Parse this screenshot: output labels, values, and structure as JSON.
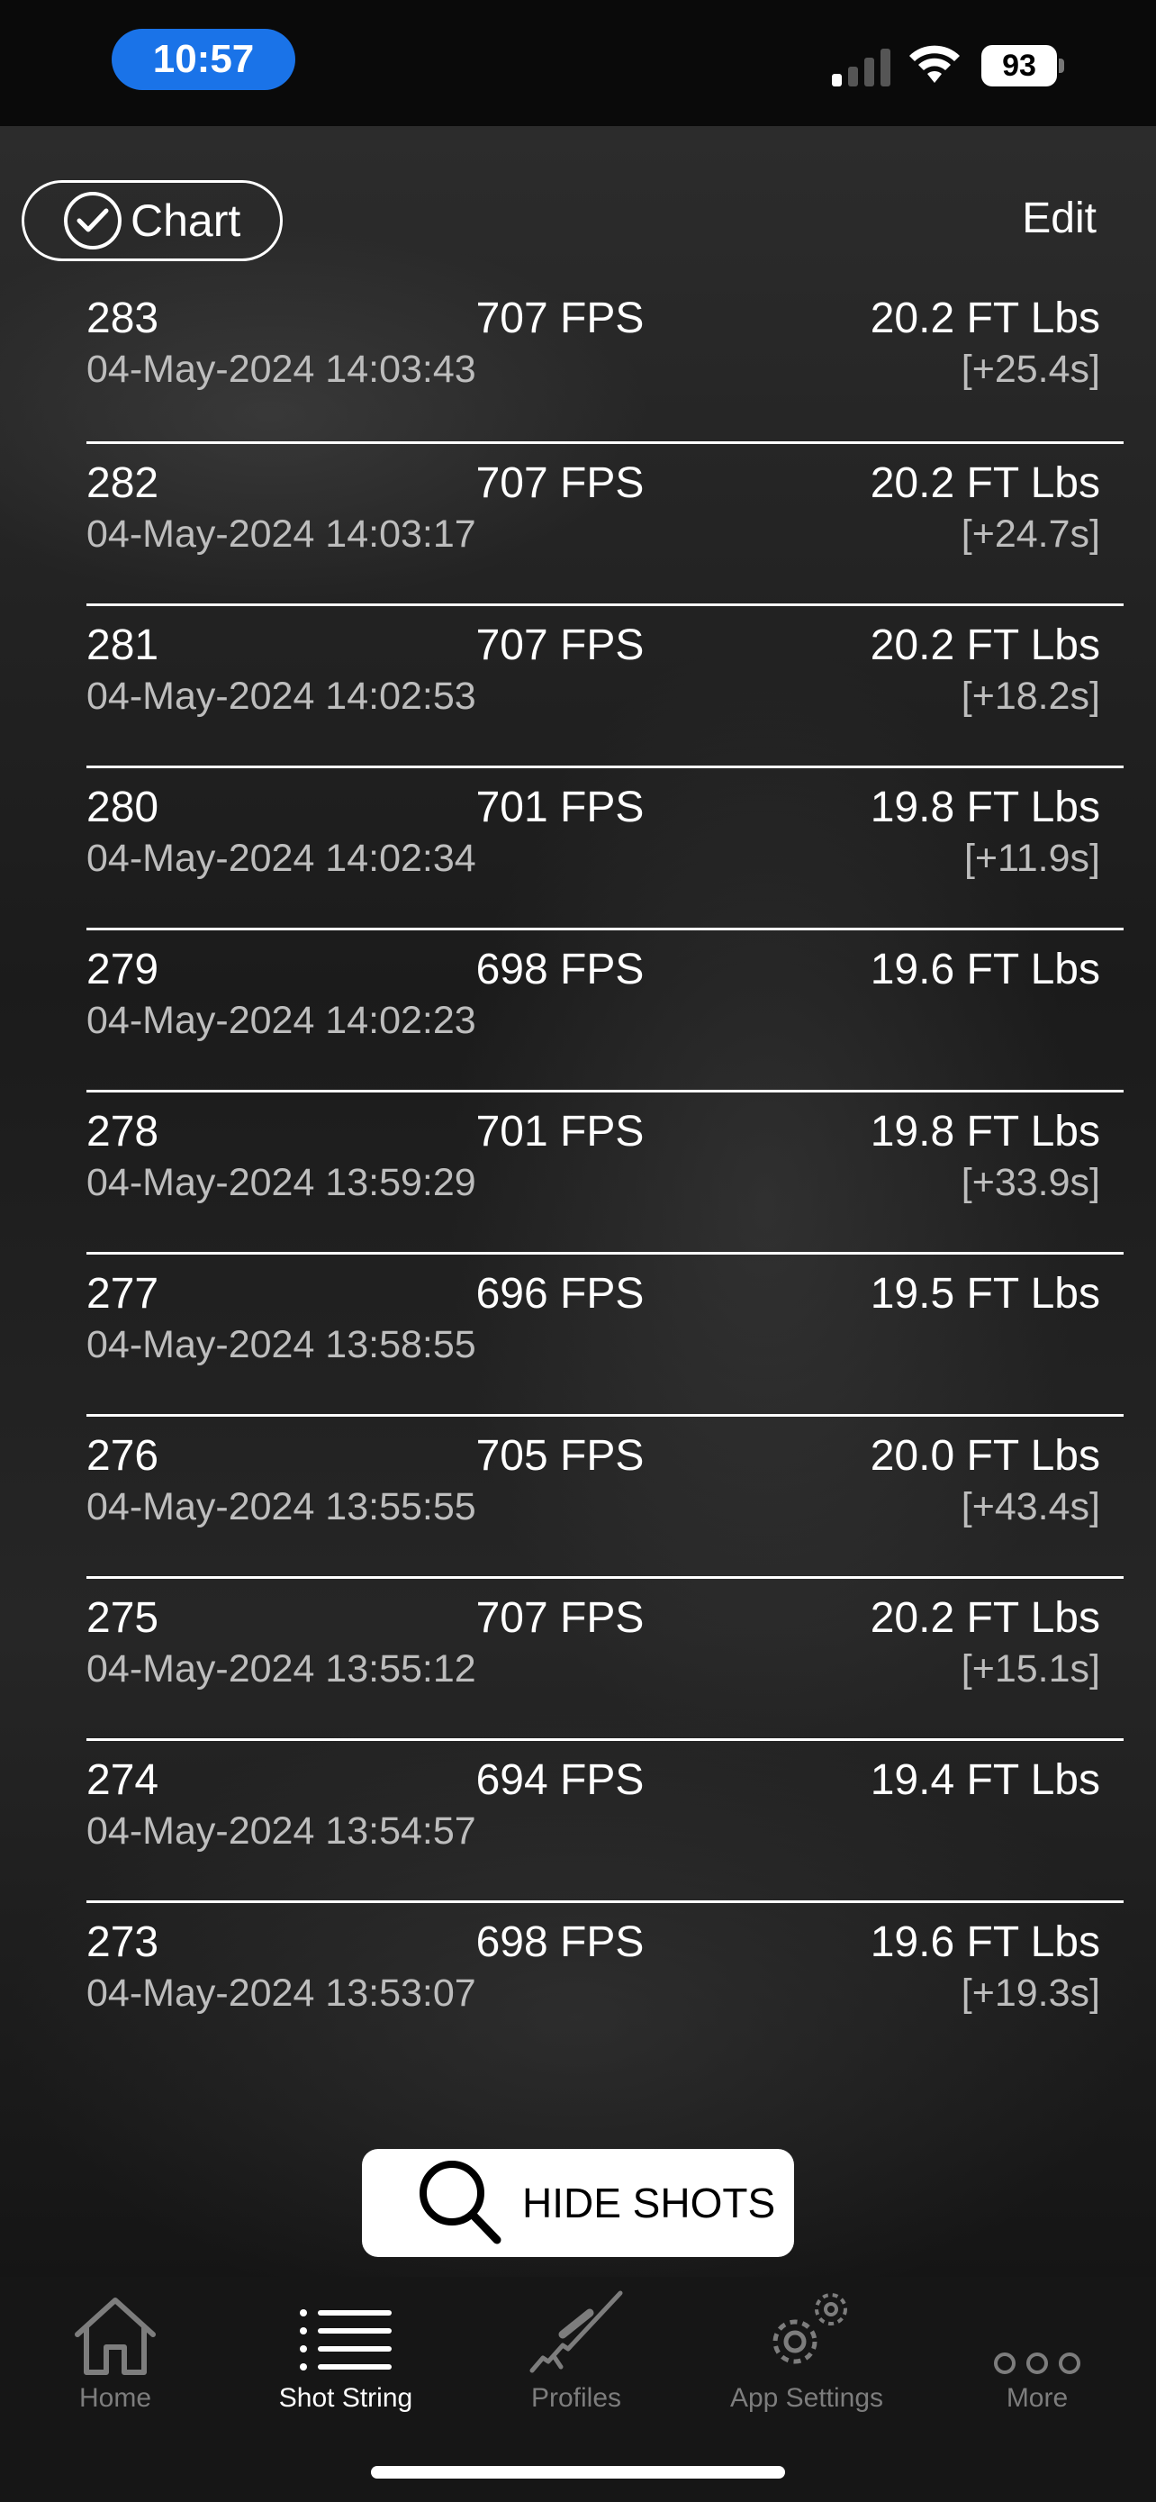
{
  "status_bar": {
    "time": "10:57",
    "battery": "93"
  },
  "toolbar": {
    "chart_label": "Chart",
    "edit_label": "Edit"
  },
  "shots": [
    {
      "num": "283",
      "fps": "707 FPS",
      "energy": "20.2 FT Lbs",
      "time": "04-May-2024 14:03:43",
      "delta": "[+25.4s]"
    },
    {
      "num": "282",
      "fps": "707 FPS",
      "energy": "20.2 FT Lbs",
      "time": "04-May-2024 14:03:17",
      "delta": "[+24.7s]"
    },
    {
      "num": "281",
      "fps": "707 FPS",
      "energy": "20.2 FT Lbs",
      "time": "04-May-2024 14:02:53",
      "delta": "[+18.2s]"
    },
    {
      "num": "280",
      "fps": "701 FPS",
      "energy": "19.8 FT Lbs",
      "time": "04-May-2024 14:02:34",
      "delta": "[+11.9s]"
    },
    {
      "num": "279",
      "fps": "698 FPS",
      "energy": "19.6 FT Lbs",
      "time": "04-May-2024 14:02:23",
      "delta": ""
    },
    {
      "num": "278",
      "fps": "701 FPS",
      "energy": "19.8 FT Lbs",
      "time": "04-May-2024 13:59:29",
      "delta": "[+33.9s]"
    },
    {
      "num": "277",
      "fps": "696 FPS",
      "energy": "19.5 FT Lbs",
      "time": "04-May-2024 13:58:55",
      "delta": ""
    },
    {
      "num": "276",
      "fps": "705 FPS",
      "energy": "20.0 FT Lbs",
      "time": "04-May-2024 13:55:55",
      "delta": "[+43.4s]"
    },
    {
      "num": "275",
      "fps": "707 FPS",
      "energy": "20.2 FT Lbs",
      "time": "04-May-2024 13:55:12",
      "delta": "[+15.1s]"
    },
    {
      "num": "274",
      "fps": "694 FPS",
      "energy": "19.4 FT Lbs",
      "time": "04-May-2024 13:54:57",
      "delta": ""
    },
    {
      "num": "273",
      "fps": "698 FPS",
      "energy": "19.6 FT Lbs",
      "time": "04-May-2024 13:53:07",
      "delta": "[+19.3s]"
    }
  ],
  "hide_button": {
    "label": "HIDE SHOTS",
    "icon": "search-icon"
  },
  "tab_bar": {
    "tabs": [
      {
        "label": "Home",
        "icon": "home-icon"
      },
      {
        "label": "Shot String",
        "icon": "list-icon",
        "active": true
      },
      {
        "label": "Profiles",
        "icon": "rifle-icon"
      },
      {
        "label": "App Settings",
        "icon": "gear-icon"
      },
      {
        "label": "More",
        "icon": "more-icon"
      }
    ]
  },
  "colors": {
    "accent_blue": "#1a73e8",
    "inactive_tab": "#7d7d7d",
    "secondary_text": "#bdbdbd"
  }
}
